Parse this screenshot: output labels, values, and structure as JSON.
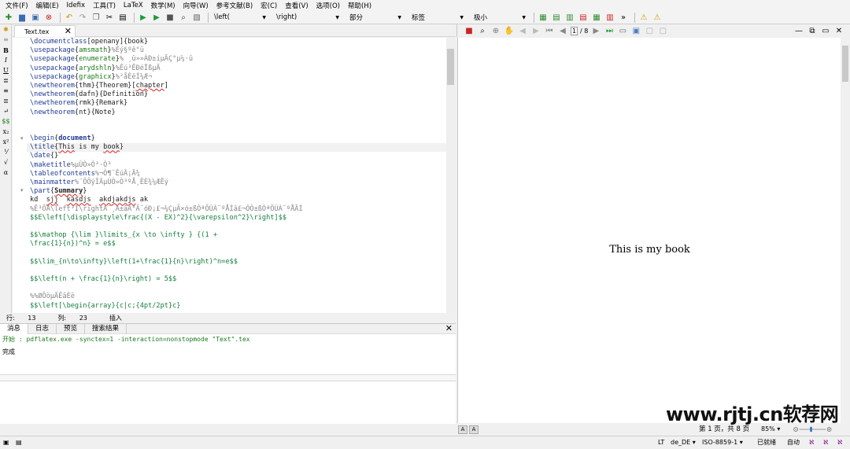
{
  "menu": [
    "文件(F)",
    "编辑(E)",
    "Idefix",
    "工具(T)",
    "LaTeX",
    "数学(M)",
    "向导(W)",
    "参考文献(B)",
    "宏(C)",
    "查看(V)",
    "选项(O)",
    "帮助(H)"
  ],
  "toolbar": {
    "left_combo": "\\left(",
    "right_combo": "\\right)",
    "part_combo": "部分",
    "label_combo": "标签",
    "size_combo": "极小"
  },
  "editor": {
    "tab_name": "Text.tex",
    "lines": [
      "\\documentclass[openany]{book}",
      "\\usepackage{amsmath}%Êý§ºê°ü",
      "\\usepackage{enumerate}% ¸û»»ÀÐ±íµÄÇ°µ¼·û",
      "\\usepackage{arydshln}%Êú³ÊÐéÏßµÄ",
      "\\usepackage{graphicx}%²åÈëÍ¼Æ¬",
      "\\newtheorem{thm}{Theorem}[chapter]",
      "\\newtheorem{dafn}{Definition}",
      "\\newtheorem{rmk}{Remark}",
      "\\newtheorem{nt}{Note}",
      "",
      "",
      "\\begin{document}",
      "\\title{This is my book}",
      "\\date{}",
      "\\maketitle%µÚÒ»Ò³·Ò³",
      "\\tableofcontents%¬Ò¶¨ÊúÂ¡Ä¾",
      "\\mainmatter%¨ÕÕýÎÄµÚÒ»Ò³ºÅ¸ÊÈ¾¼ÆËý",
      "\\part{Summary}",
      "kd  sjj  kasdjs  akdjakdjs ak",
      "%Ê³ÔÅ\\left³Í\\rightÀ¨¸Ä±ãÄ°Ä¨óÐ¡£¬¼ÇµÃ×ó±ßÒªÕÙÀ¨ºÅÍâ£¬ÓÒ±ßÒªÕÙÀ¨ºÅÄÍ",
      "$$E\\left[\\displaystyle\\frac{(X - EX)^2}{\\varepsilon^2}\\right]$$",
      "",
      "$$\\mathop {\\lim }\\limits_{x \\to \\infty } {(1 +",
      "\\frac{1}{n})^n} = e$$",
      "",
      "$$\\lim_{n\\to\\infty}\\left(1+\\frac{1}{n}\\right)^n=e$$",
      "",
      "$$\\left(n + \\frac{1}{n}\\right) = 5$$",
      "",
      "%%ØÔöµÄÊãÈë",
      "$$\\left[\\begin{array}{c|c;{4pt/2pt}c}"
    ],
    "status": {
      "row_label": "行:",
      "row": "13",
      "col_label": "列:",
      "col": "23",
      "mode": "插入"
    }
  },
  "messages": {
    "tabs": [
      "消息",
      "日志",
      "预览",
      "搜索结果"
    ],
    "line1": "开始 : pdflatex.exe -synctex=1 -interaction=nonstopmode \"Text\".tex",
    "line2": "完成"
  },
  "pdf": {
    "page_current": "1",
    "page_total": "/ 8",
    "title_text": "This is my book",
    "page_info": "第 1 页，共 8 页",
    "zoom": "85%"
  },
  "bottombar": {
    "lang": "de_DE",
    "encoding": "ISO-8859-1",
    "ready": "已就绪",
    "auto": "自动"
  },
  "watermark": "www.rjtj.cn软荐网"
}
